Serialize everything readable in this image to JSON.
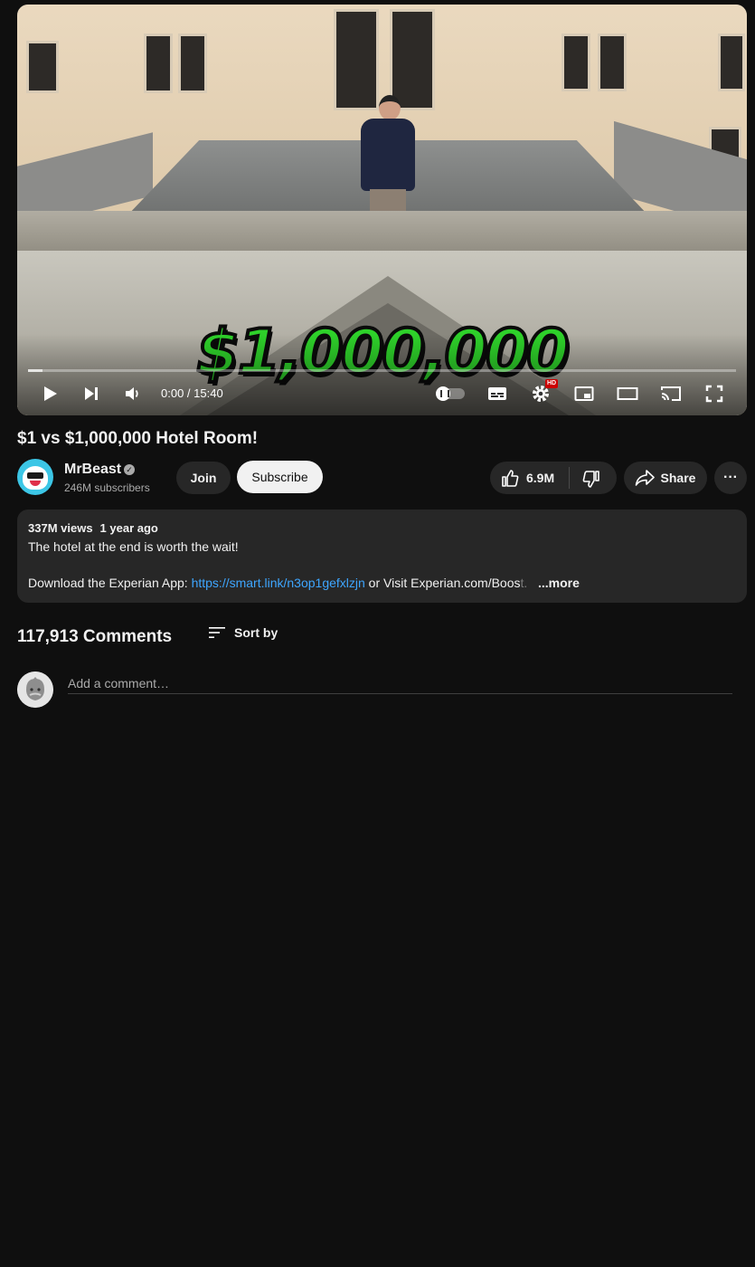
{
  "video": {
    "overlay_text": "$1,000,000",
    "time_current": "0:00",
    "time_separator": " / ",
    "time_total": "15:40",
    "quality_badge": "HD",
    "progress_buffered": 0.02
  },
  "title": "$1 vs $1,000,000 Hotel Room!",
  "channel": {
    "name": "MrBeast",
    "verified_mark": "✓",
    "subscribers": "246M subscribers"
  },
  "actions": {
    "join_label": "Join",
    "subscribe_label": "Subscribe",
    "like_count": "6.9M",
    "share_label": "Share",
    "more_label": "···"
  },
  "description": {
    "views": "337M views",
    "age": "1 year ago",
    "line1": "The hotel at the end is worth the wait!",
    "line2_prefix": "Download the Experian App: ",
    "link": "https://smart.link/n3op1gefxlzjn",
    "line2_suffix": " or Visit Experian.com/Boos",
    "line2_fade": "t.",
    "more_label": "...more"
  },
  "comments": {
    "count_label": "117,913 Comments",
    "sort_label": "Sort by",
    "placeholder": "Add a comment…"
  },
  "colors": {
    "background": "#0f0f0f",
    "surface": "#272727",
    "link": "#3ea6ff",
    "overlay_green": "#2ed12a"
  }
}
